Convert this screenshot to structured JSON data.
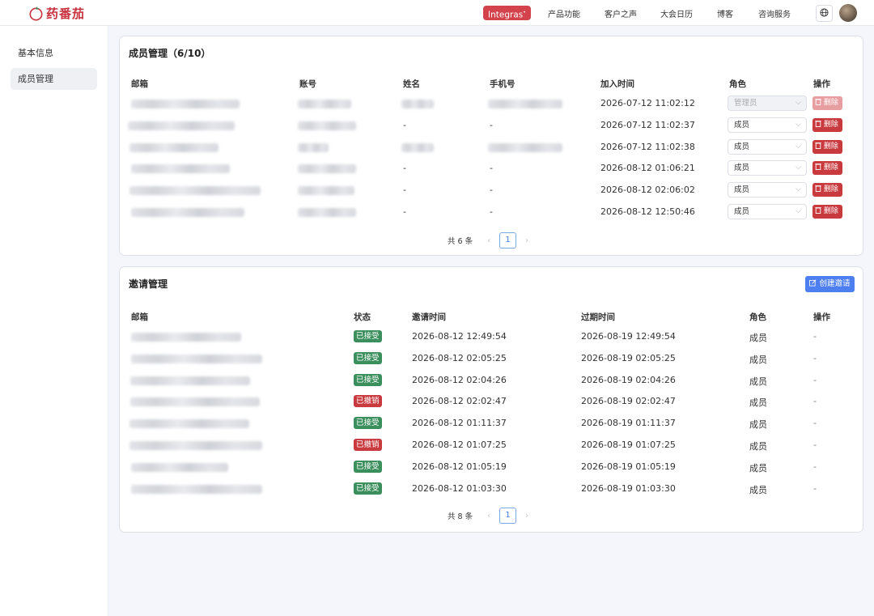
{
  "app": {
    "logo_text": "药番茄",
    "badge": "Integras",
    "nav": [
      "产品功能",
      "客户之声",
      "大会日历",
      "博客",
      "咨询服务"
    ]
  },
  "sidebar": {
    "items": [
      {
        "label": "基本信息",
        "active": false
      },
      {
        "label": "成员管理",
        "active": true
      }
    ]
  },
  "members": {
    "title": "成员管理（6/10）",
    "headers": [
      "邮箱",
      "账号",
      "姓名",
      "手机号",
      "加入时间",
      "角色",
      "操作"
    ],
    "rows": [
      {
        "name": "",
        "phone": "",
        "joined": "2026-07-12 11:02:12",
        "role": "管理员",
        "disabled": true
      },
      {
        "name": "-",
        "phone": "-",
        "joined": "2026-07-12 11:02:37",
        "role": "成员",
        "disabled": false
      },
      {
        "name": "",
        "phone": "",
        "joined": "2026-07-12 11:02:38",
        "role": "成员",
        "disabled": false
      },
      {
        "name": "-",
        "phone": "-",
        "joined": "2026-08-12 01:06:21",
        "role": "成员",
        "disabled": false
      },
      {
        "name": "-",
        "phone": "-",
        "joined": "2026-08-12 02:06:02",
        "role": "成员",
        "disabled": false
      },
      {
        "name": "-",
        "phone": "-",
        "joined": "2026-08-12 12:50:46",
        "role": "成员",
        "disabled": false
      }
    ],
    "delete_label": "删除",
    "pager": {
      "total": "共 6 条",
      "page": "1"
    }
  },
  "invites": {
    "title": "邀请管理",
    "create_label": "创建邀请",
    "headers": [
      "邮箱",
      "状态",
      "邀请时间",
      "过期时间",
      "角色",
      "操作"
    ],
    "rows": [
      {
        "status": "已接受",
        "status_kind": "ok",
        "invited": "2026-08-12 12:49:54",
        "expires": "2026-08-19 12:49:54",
        "role": "成员",
        "action": "-"
      },
      {
        "status": "已接受",
        "status_kind": "ok",
        "invited": "2026-08-12 02:05:25",
        "expires": "2026-08-19 02:05:25",
        "role": "成员",
        "action": "-"
      },
      {
        "status": "已接受",
        "status_kind": "ok",
        "invited": "2026-08-12 02:04:26",
        "expires": "2026-08-19 02:04:26",
        "role": "成员",
        "action": "-"
      },
      {
        "status": "已撤销",
        "status_kind": "revoked",
        "invited": "2026-08-12 02:02:47",
        "expires": "2026-08-19 02:02:47",
        "role": "成员",
        "action": "-"
      },
      {
        "status": "已接受",
        "status_kind": "ok",
        "invited": "2026-08-12 01:11:37",
        "expires": "2026-08-19 01:11:37",
        "role": "成员",
        "action": "-"
      },
      {
        "status": "已撤销",
        "status_kind": "revoked",
        "invited": "2026-08-12 01:07:25",
        "expires": "2026-08-19 01:07:25",
        "role": "成员",
        "action": "-"
      },
      {
        "status": "已接受",
        "status_kind": "ok",
        "invited": "2026-08-12 01:05:19",
        "expires": "2026-08-19 01:05:19",
        "role": "成员",
        "action": "-"
      },
      {
        "status": "已接受",
        "status_kind": "ok",
        "invited": "2026-08-12 01:03:30",
        "expires": "2026-08-19 01:03:30",
        "role": "成员",
        "action": "-"
      }
    ],
    "pager": {
      "total": "共 8 条",
      "page": "1"
    }
  },
  "colors": {
    "brand": "#c8333e",
    "success": "#3a8f5c",
    "danger": "#c93a3f",
    "primary": "#4e7ff0"
  },
  "icons": [
    "tomato-logo-icon",
    "globe-icon",
    "chevron-down-icon",
    "trash-icon",
    "edit-icon",
    "chevron-left-icon",
    "chevron-right-icon"
  ]
}
